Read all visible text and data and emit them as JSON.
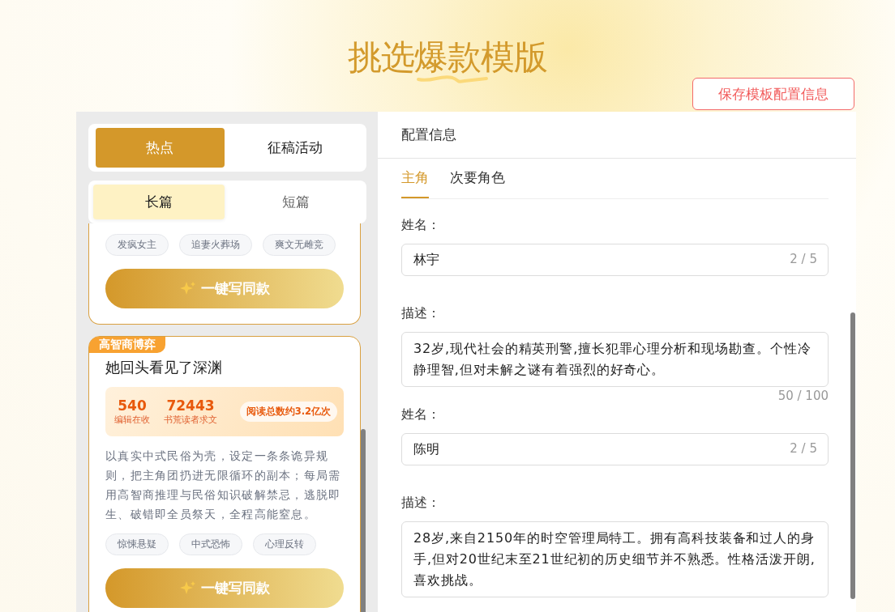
{
  "title": "挑选爆款模版",
  "save_button": "保存模板配置信息",
  "source_tabs": [
    {
      "label": "热点",
      "selected": true
    },
    {
      "label": "征稿活动",
      "selected": false
    }
  ],
  "length_tabs": [
    {
      "label": "长篇",
      "selected": true
    },
    {
      "label": "短篇",
      "selected": false
    }
  ],
  "cards": [
    {
      "partial": true,
      "tags": [
        "发疯女主",
        "追妻火葬场",
        "爽文无雌竞"
      ],
      "action": "一键写同款"
    },
    {
      "partial": false,
      "badge": "高智商博弈",
      "title": "她回头看见了深渊",
      "stats": [
        {
          "value": "540",
          "label": "编辑在收"
        },
        {
          "value": "72443",
          "label": "书荒读者求文"
        }
      ],
      "highlight": "阅读总数约3.2亿次",
      "description": "以真实中式民俗为壳，设定一条条诡异规则，把主角团扔进无限循环的副本；每局需用高智商推理与民俗知识破解禁忌，逃脱即生、破错即全员祭天，全程高能窒息。",
      "tags": [
        "惊悚悬疑",
        "中式恐怖",
        "心理反转"
      ],
      "action": "一键写同款"
    }
  ],
  "config": {
    "heading": "配置信息",
    "tabs": [
      {
        "label": "主角",
        "selected": true
      },
      {
        "label": "次要角色",
        "selected": false
      }
    ],
    "fields": [
      {
        "kind": "input",
        "label": "姓名：",
        "value": "林宇",
        "counter": "2 / 5"
      },
      {
        "kind": "textarea",
        "label": "描述：",
        "value": "32岁,现代社会的精英刑警,擅长犯罪心理分析和现场勘查。个性冷静理智,但对未解之谜有着强烈的好奇心。",
        "counter": "50 / 100"
      },
      {
        "kind": "input",
        "label": "姓名：",
        "value": "陈明",
        "counter": "2 / 5"
      },
      {
        "kind": "textarea",
        "label": "描述：",
        "value": "28岁,来自2150年的时空管理局特工。拥有高科技装备和过人的身手,但对20世纪末至21世纪初的历史细节并不熟悉。性格活泼开朗,喜欢挑战。"
      }
    ]
  }
}
